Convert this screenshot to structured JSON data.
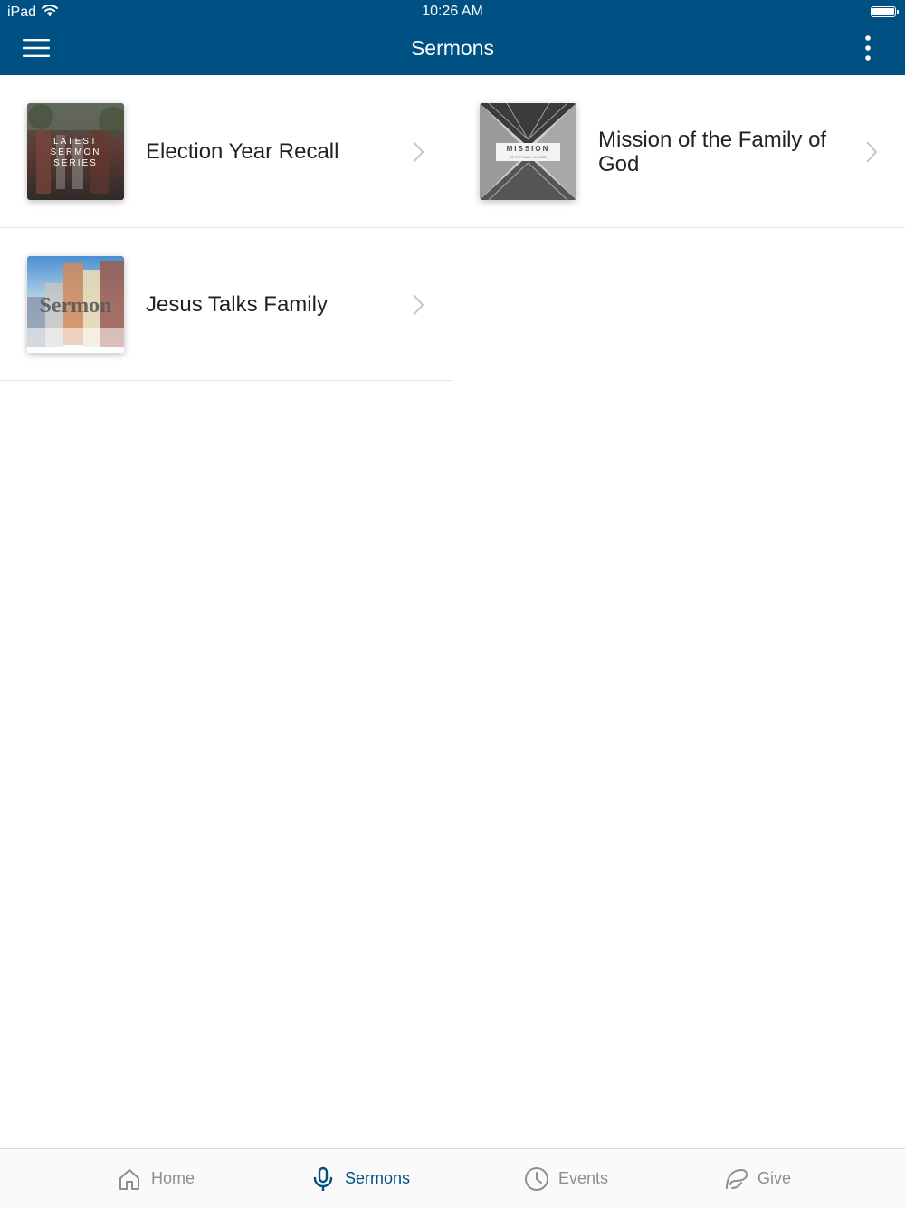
{
  "status_bar": {
    "carrier": "iPad",
    "time": "10:26 AM"
  },
  "nav": {
    "title": "Sermons",
    "menu_icon": "hamburger-menu-icon",
    "more_icon": "vertical-dots-icon"
  },
  "sermons": [
    {
      "title": "Election Year Recall",
      "thumbnail_text": [
        "LATEST",
        "SERMON",
        "SERIES"
      ]
    },
    {
      "title": "Mission of the Family of God",
      "thumbnail_text": [
        "MISSION",
        "OF THE FAMILY OF GOD"
      ]
    },
    {
      "title": "Jesus Talks Family",
      "thumbnail_text": [
        "Sermon"
      ]
    }
  ],
  "tabs": [
    {
      "label": "Home",
      "icon": "home-icon",
      "active": false
    },
    {
      "label": "Sermons",
      "icon": "microphone-icon",
      "active": true
    },
    {
      "label": "Events",
      "icon": "clock-icon",
      "active": false
    },
    {
      "label": "Give",
      "icon": "give-icon",
      "active": false
    }
  ],
  "colors": {
    "brand": "#005183",
    "inactive_tab": "#8e8e8e"
  }
}
